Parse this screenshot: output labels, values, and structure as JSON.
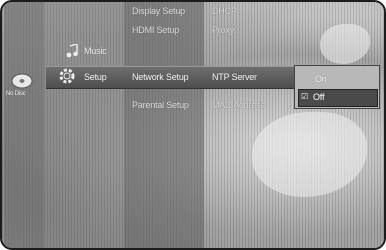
{
  "left_panel": {
    "disc_label": "No Disc",
    "disc_icon": "disc-icon"
  },
  "categories": [
    {
      "label": "Music",
      "icon": "music-icon"
    },
    {
      "label": "Setup",
      "icon": "gear-icon"
    }
  ],
  "setup_menu": {
    "items": [
      "Display Setup",
      "HDMI Setup",
      "Network Setup",
      "Parental Setup"
    ],
    "selected": "Network Setup"
  },
  "network_menu": {
    "items": [
      "DHCP",
      "Proxy",
      "NTP Server",
      "MAC Address"
    ],
    "selected": "NTP Server"
  },
  "ntp_popup": {
    "options": [
      "On",
      "Off"
    ],
    "selected": "Off",
    "check_mark": "☑"
  }
}
